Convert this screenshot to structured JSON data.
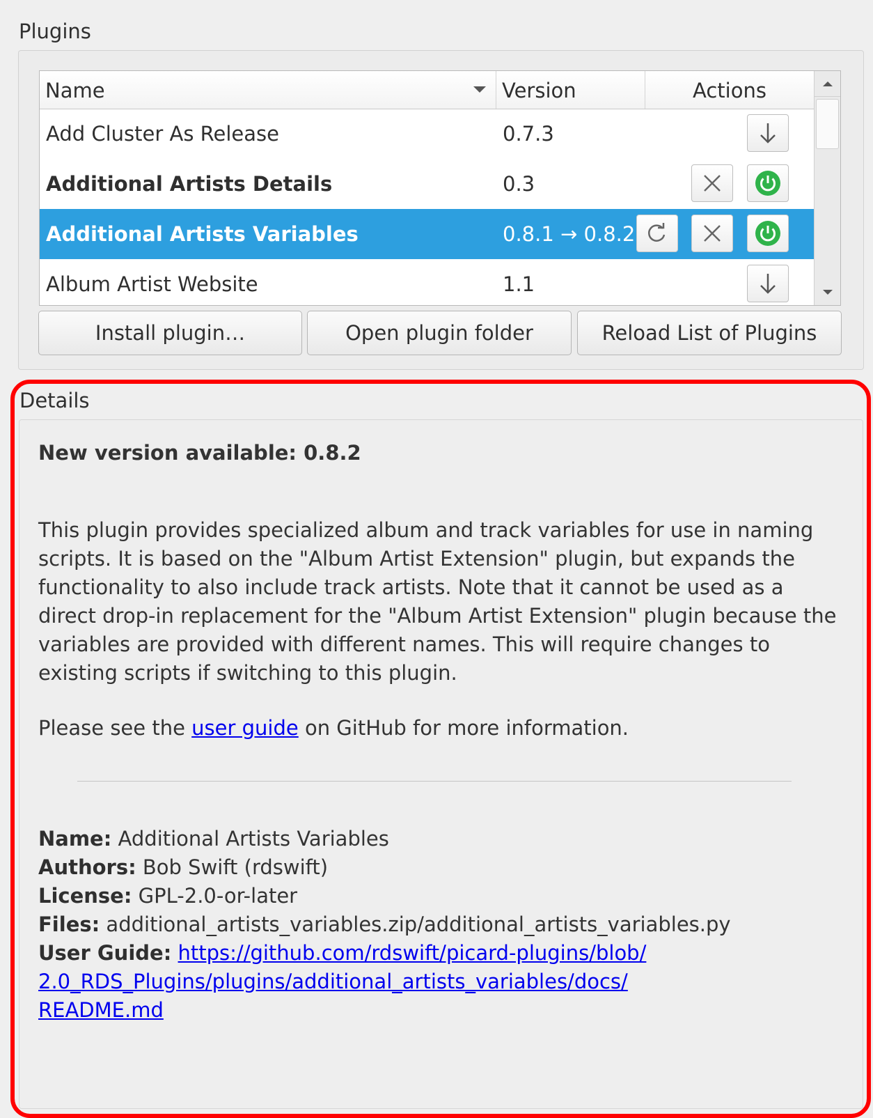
{
  "plugins_group": {
    "title": "Plugins",
    "columns": {
      "name": "Name",
      "version": "Version",
      "actions": "Actions"
    },
    "rows": [
      {
        "name": "Add Cluster As Release",
        "version": "0.7.3",
        "style": "normal",
        "actions": [
          "install-icon"
        ]
      },
      {
        "name": "Additional Artists Details",
        "version": "0.3",
        "style": "bold",
        "actions": [
          "uninstall-icon",
          "enable-power-icon"
        ]
      },
      {
        "name": "Additional Artists Variables",
        "version": "0.8.1 → 0.8.2",
        "style": "selected",
        "actions": [
          "update-icon",
          "uninstall-icon",
          "enable-power-icon"
        ]
      },
      {
        "name": "Album Artist Website",
        "version": "1.1",
        "style": "normal",
        "actions": [
          "install-icon"
        ]
      }
    ],
    "buttons": {
      "install": "Install plugin…",
      "open_folder": "Open plugin folder",
      "reload": "Reload List of Plugins"
    }
  },
  "details_group": {
    "title": "Details",
    "new_version": "New version available: 0.8.2",
    "description": "This plugin provides specialized album and track variables for use in naming scripts. It is based on the \"Album Artist Extension\" plugin, but expands the functionality to also include track artists. Note that it cannot be used as a direct drop-in replacement for the \"Album Artist Extension\" plugin because the variables are provided with different names. This will require changes to existing scripts if switching to this plugin.",
    "guide_prefix": "Please see the ",
    "guide_link": "user guide",
    "guide_suffix": " on GitHub for more information.",
    "meta": {
      "name_label": "Name:",
      "name_value": " Additional Artists Variables",
      "authors_label": "Authors:",
      "authors_value": " Bob Swift (rdswift)",
      "license_label": "License:",
      "license_value": " GPL-2.0-or-later",
      "files_label": "Files:",
      "files_value": " additional_artists_variables.zip/additional_artists_variables.py",
      "guide_label": "User Guide:",
      "guide_url_1": "https://github.com/rdswift/picard-plugins/blob/",
      "guide_url_2": "2.0_RDS_Plugins/plugins/additional_artists_variables/docs/",
      "guide_url_3": "README.md"
    }
  },
  "colors": {
    "selection": "#2d9fdf",
    "highlight_border": "#ff0000",
    "power_green": "#2fb34a",
    "link": "#0000ee"
  }
}
